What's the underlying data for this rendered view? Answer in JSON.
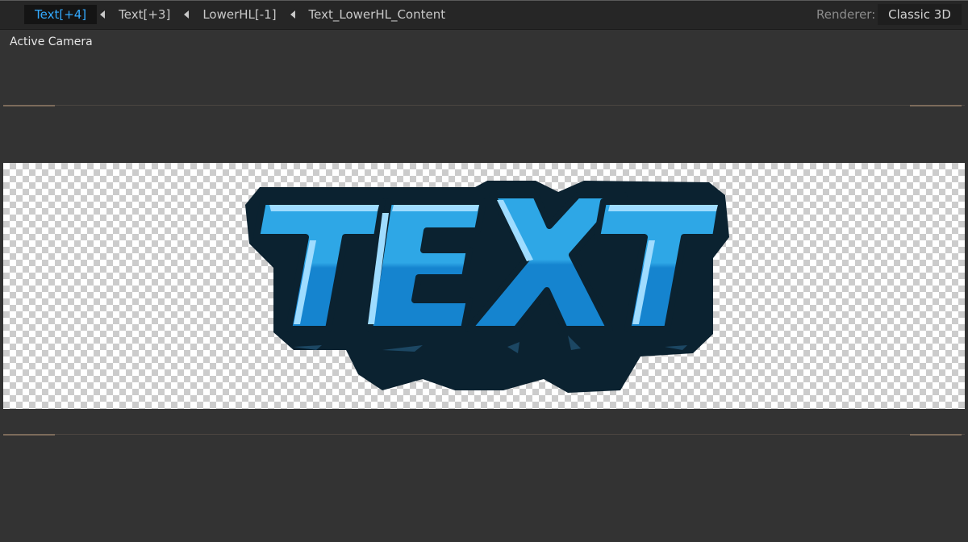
{
  "breadcrumbs": [
    {
      "label": "Text[+4]",
      "active": true
    },
    {
      "label": "Text[+3]",
      "active": false
    },
    {
      "label": "LowerHL[-1]",
      "active": false
    },
    {
      "label": "Text_LowerHL_Content",
      "active": false
    }
  ],
  "renderer": {
    "label": "Renderer:",
    "value": "Classic 3D"
  },
  "viewer": {
    "camera_label": "Active Camera"
  },
  "composition": {
    "logo_text": "TEXT",
    "colors": {
      "outline": "#0b2230",
      "face_light": "#2ea7e6",
      "face_dark": "#1584cf",
      "highlight": "#9fdcff",
      "transparency_grid": "#cccccc"
    }
  },
  "colors": {
    "accent": "#33aaff",
    "panel_bg": "#333333",
    "toolbar_bg": "#262626"
  }
}
